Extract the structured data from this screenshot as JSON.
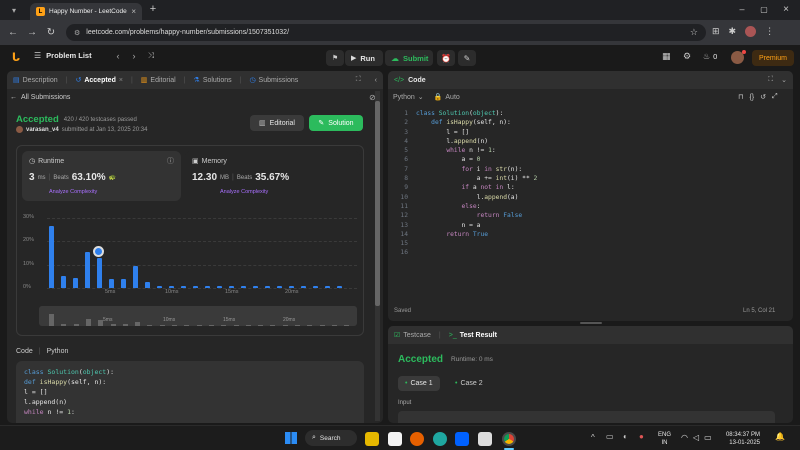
{
  "browser": {
    "tab_title": "Happy Number - LeetCode",
    "url": "leetcode.com/problems/happy-number/submissions/1507351032/"
  },
  "nav": {
    "problem_list": "Problem List",
    "run": "Run",
    "submit": "Submit",
    "coins": "0",
    "premium": "Premium"
  },
  "left": {
    "tabs": [
      "Description",
      "Accepted",
      "Editorial",
      "Solutions",
      "Submissions"
    ],
    "all_submissions": "All Submissions",
    "status": "Accepted",
    "passed": "420 / 420 testcases passed",
    "user": "varasan_v4",
    "submitted": "submitted at Jan 13, 2025 20:34",
    "editorial_btn": "Editorial",
    "solution_btn": "Solution",
    "runtime": {
      "label": "Runtime",
      "value": "3",
      "unit": "ms",
      "beats_label": "Beats",
      "beats": "63.10%",
      "analyze": "Analyze Complexity"
    },
    "memory": {
      "label": "Memory",
      "value": "12.30",
      "unit": "MB",
      "beats_label": "Beats",
      "beats": "35.67%",
      "analyze": "Analyze Complexity"
    },
    "code_label": "Code",
    "lang": "Python",
    "code_preview": [
      "class Solution(object):",
      "    def isHappy(self, n):",
      "        l = []",
      "        l.append(n)",
      "        while n != 1:"
    ]
  },
  "chart_data": {
    "type": "bar",
    "y_ticks": [
      "30%",
      "20%",
      "10%",
      "0%"
    ],
    "x_ticks": [
      "5ms",
      "10ms",
      "15ms",
      "20ms"
    ],
    "ylim": [
      0,
      30
    ],
    "values": [
      26.5,
      5,
      4.5,
      15.5,
      13,
      4,
      4,
      9.5,
      2.5,
      1,
      1,
      1,
      1,
      1,
      1,
      1,
      1,
      1,
      1,
      1,
      1,
      1,
      1,
      1,
      1
    ]
  },
  "editor": {
    "title": "Code",
    "lang": "Python",
    "mode": "Auto",
    "saved": "Saved",
    "position": "Ln 5, Col 21",
    "lines": [
      "class Solution(object):",
      "    def isHappy(self, n):",
      "        l = []",
      "        l.append(n)",
      "        while n != 1:",
      "            a = 0",
      "            for i in str(n):",
      "                a += int(i) ** 2",
      "            if a not in l:",
      "                l.append(a)",
      "            else:",
      "                return False",
      "            n = a",
      "        return True",
      "",
      ""
    ]
  },
  "result": {
    "testcase_tab": "Testcase",
    "result_tab": "Test Result",
    "status": "Accepted",
    "runtime": "Runtime: 0 ms",
    "case1": "Case 1",
    "case2": "Case 2",
    "input_label": "Input"
  },
  "taskbar": {
    "search": "Search",
    "lang1": "ENG",
    "lang2": "IN",
    "time": "08:34:37 PM",
    "date": "13-01-2025"
  }
}
